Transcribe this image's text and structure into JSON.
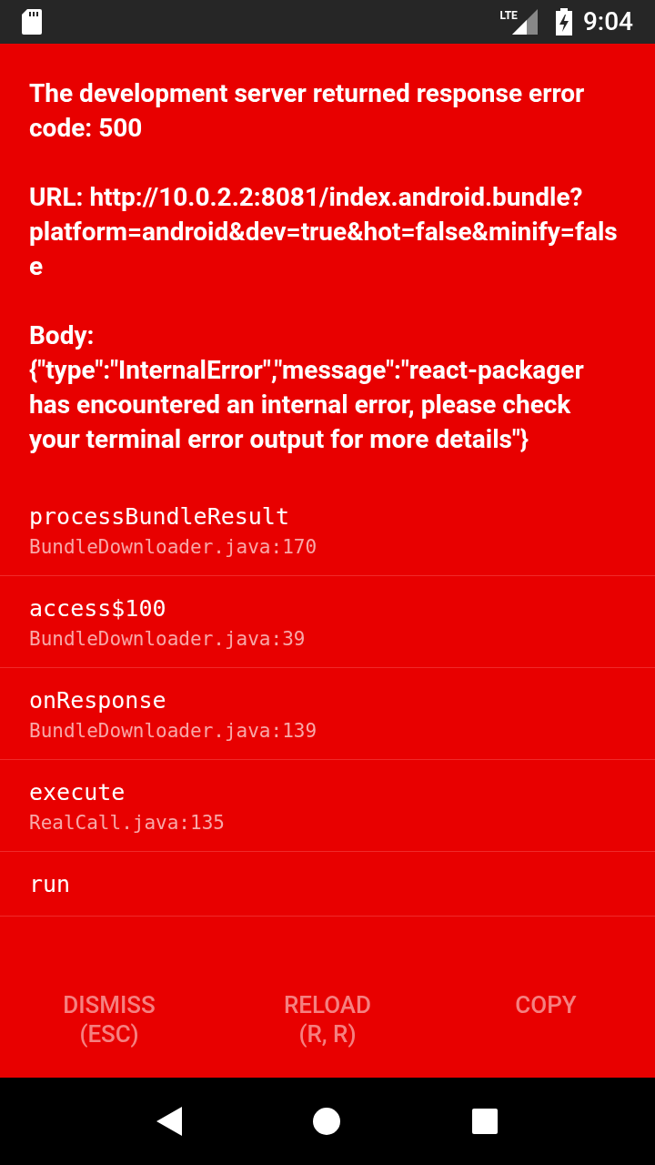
{
  "status_bar": {
    "network": "LTE",
    "time": "9:04"
  },
  "error": {
    "paragraphs": [
      "The development server returned response error code: 500",
      "URL: http://10.0.2.2:8081/index.android.bundle?platform=android&dev=true&hot=false&minify=false",
      "Body:\n{\"type\":\"InternalError\",\"message\":\"react-packager has encountered an internal error, please check your terminal error output for more details\"}"
    ]
  },
  "stack_frames": [
    {
      "method": "processBundleResult",
      "location": "BundleDownloader.java:170"
    },
    {
      "method": "access$100",
      "location": "BundleDownloader.java:39"
    },
    {
      "method": "onResponse",
      "location": "BundleDownloader.java:139"
    },
    {
      "method": "execute",
      "location": "RealCall.java:135"
    },
    {
      "method": "run"
    }
  ],
  "buttons": [
    {
      "label": "DISMISS",
      "shortcut": "(ESC)"
    },
    {
      "label": "RELOAD",
      "shortcut": "(R, R)"
    },
    {
      "label": "COPY"
    }
  ]
}
